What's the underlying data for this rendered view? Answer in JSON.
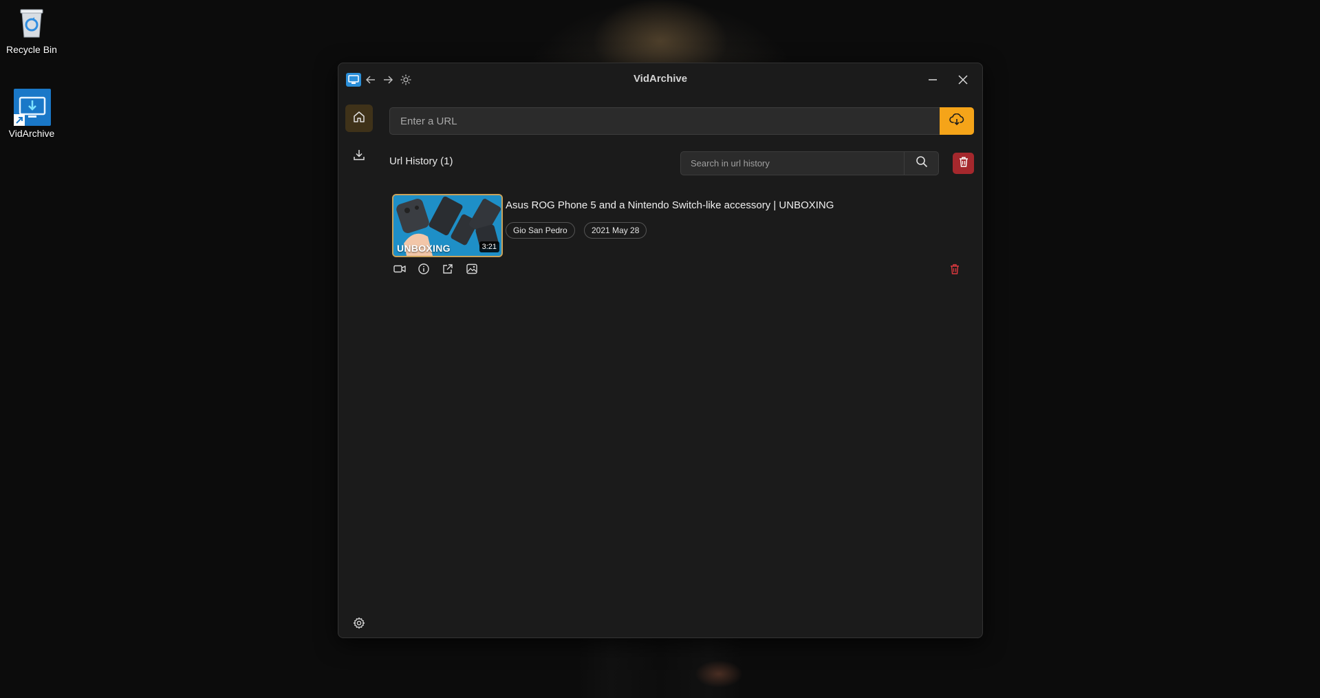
{
  "desktop": {
    "icons": [
      {
        "label": "Recycle Bin",
        "icon": "recycle-bin-icon"
      },
      {
        "label": "VidArchive",
        "icon": "vidarchive-shortcut-icon"
      }
    ]
  },
  "window": {
    "title": "VidArchive",
    "titlebar_icons": [
      "app-logo-icon",
      "back-arrow-icon",
      "forward-arrow-icon",
      "theme-toggle-icon",
      "minimize-icon",
      "close-icon"
    ]
  },
  "sidebar": {
    "items": [
      {
        "name": "home",
        "icon": "home-icon",
        "active": true
      },
      {
        "name": "downloads",
        "icon": "download-icon",
        "active": false
      }
    ],
    "footer_icon": "settings-gear-icon"
  },
  "url_bar": {
    "placeholder": "Enter a URL",
    "value": "",
    "submit_icon": "cloud-download-icon"
  },
  "history": {
    "title": "Url History (1)",
    "search_placeholder": "Search in url history",
    "items": [
      {
        "title": "Asus ROG Phone 5 and a Nintendo Switch-like accessory | UNBOXING",
        "thumbnail_text": "UNBOXING",
        "duration": "3:21",
        "channel": "Gio San Pedro",
        "date": "2021 May 28",
        "actions": [
          "video-icon",
          "info-icon",
          "open-external-icon",
          "image-icon"
        ]
      }
    ]
  },
  "colors": {
    "accent": "#f5a419",
    "danger": "#a5282d",
    "window_bg": "#1b1b1b",
    "active_nav_bg": "#3f3219"
  }
}
